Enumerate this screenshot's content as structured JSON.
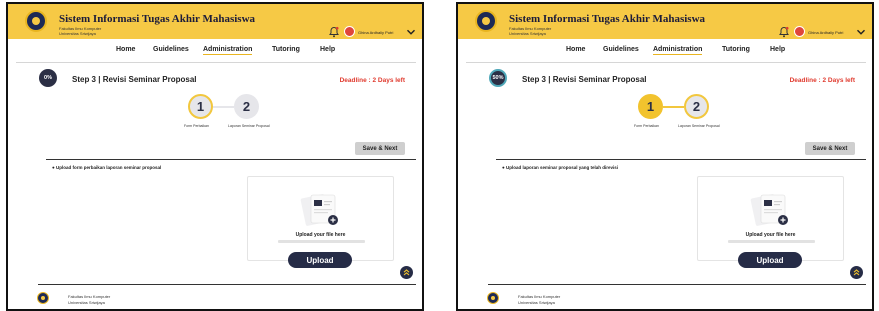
{
  "app": {
    "title": "Sistem Informasi Tugas Akhir Mahasiswa",
    "faculty": "Fakultas Ilmu Komputer",
    "university": "Universitas Sriwijaya",
    "user_name": "Ghina Ardhaliy Putri"
  },
  "nav": [
    "Home",
    "Guidelines",
    "Administration",
    "Tutoring",
    "Help"
  ],
  "nav_active": "Administration",
  "colors": {
    "topbar": "#F6C945",
    "accent": "#F2C32E",
    "primary_dark": "#262C47",
    "deadline_red": "#E03A2E"
  },
  "screens": [
    {
      "progress": "0%",
      "step_title": "Step 3 | Revisi Seminar Proposal",
      "deadline": "Deadline : 2 Days left",
      "steps": [
        {
          "number": "1",
          "label": "Form Perbaikan"
        },
        {
          "number": "2",
          "label": "Laporan Seminar Proposal"
        }
      ],
      "current_step": 1,
      "save_label": "Save & Next",
      "instruction": "● Upload form perbaikan laporan seminar proposal",
      "dropzone_text": "Upload your file here",
      "upload_label": "Upload"
    },
    {
      "progress": "50%",
      "step_title": "Step 3 | Revisi Seminar Proposal",
      "deadline": "Deadline : 2 Days left",
      "steps": [
        {
          "number": "1",
          "label": "Form Perbaikan"
        },
        {
          "number": "2",
          "label": "Laporan Seminar Proposal"
        }
      ],
      "current_step": 2,
      "save_label": "Save & Next",
      "instruction": "● Upload laporan seminar proposal yang telah direvisi",
      "dropzone_text": "Upload your file here",
      "upload_label": "Upload"
    }
  ],
  "icons": {
    "logo": "university-logo",
    "bell": "notification-bell-icon",
    "chevron": "chevron-down-icon",
    "file": "file-upload-icon",
    "to_top": "double-chevron-up-icon"
  }
}
